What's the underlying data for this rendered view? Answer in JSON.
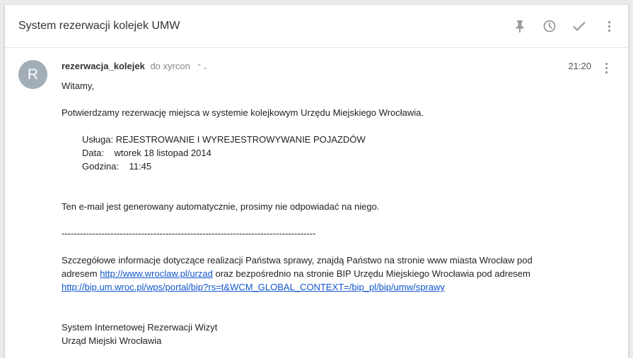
{
  "header": {
    "subject": "System rezerwacji kolejek UMW"
  },
  "message": {
    "avatar_letter": "R",
    "sender": "rezerwacja_kolejek",
    "recipient": "do xyrcon",
    "time": "21:20",
    "greeting": "Witamy,",
    "confirm": "Potwierdzamy rezerwację miejsca w systemie kolejkowym Urzędu Miejskiego Wrocławia.",
    "service": "Usługa: REJESTROWANIE I WYREJESTROWYWANIE POJAZDÓW",
    "date": "Data:    wtorek 18 listopad 2014",
    "hour": "Godzina:    11:45",
    "auto_notice": "Ten e-mail jest generowany automatycznie, prosimy nie odpowiadać na niego.",
    "separator": "-----------------------------------------------------------------------------------",
    "info_part1": "Szczegółowe informacje dotyczące realizacji Państwa sprawy, znajdą Państwo na stronie www miasta Wrocław pod",
    "info_part2a": "adresem ",
    "link1": "http://www.wroclaw.pl/urzad",
    "info_part2b": " oraz bezpośrednio na stronie BIP Urzędu Miejskiego Wrocławia pod adresem",
    "link2": "http://bip.um.wroc.pl/wps/portal/bip?rs=t&WCM_GLOBAL_CONTEXT=/bip_pl/bip/umw/sprawy",
    "signature1": "System Internetowej Rezerwacji Wizyt",
    "signature2": "Urząd Miejski Wrocławia"
  },
  "icons": {
    "pin": "pin-icon",
    "snooze": "clock-icon",
    "done": "check-icon",
    "more": "more-vert-icon"
  }
}
